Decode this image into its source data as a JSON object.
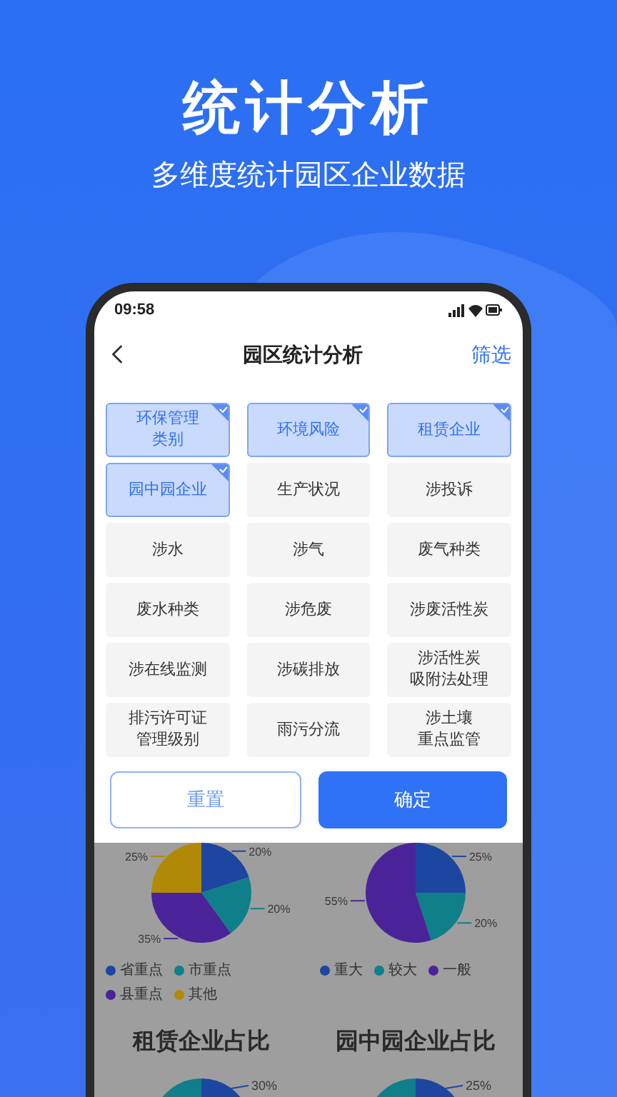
{
  "hero": {
    "title": "统计分析",
    "subtitle": "多维度统计园区企业数据"
  },
  "status_bar": {
    "time": "09:58"
  },
  "nav": {
    "title": "园区统计分析",
    "action": "筛选"
  },
  "filters": [
    {
      "lines": [
        "环保管理",
        "类别"
      ],
      "selected": true
    },
    {
      "lines": [
        "环境风险"
      ],
      "selected": true
    },
    {
      "lines": [
        "租赁企业"
      ],
      "selected": true
    },
    {
      "lines": [
        "园中园企业"
      ],
      "selected": true
    },
    {
      "lines": [
        "生产状况"
      ],
      "selected": false
    },
    {
      "lines": [
        "涉投诉"
      ],
      "selected": false
    },
    {
      "lines": [
        "涉水"
      ],
      "selected": false
    },
    {
      "lines": [
        "涉气"
      ],
      "selected": false
    },
    {
      "lines": [
        "废气种类"
      ],
      "selected": false
    },
    {
      "lines": [
        "废水种类"
      ],
      "selected": false
    },
    {
      "lines": [
        "涉危废"
      ],
      "selected": false
    },
    {
      "lines": [
        "涉废活性炭"
      ],
      "selected": false
    },
    {
      "lines": [
        "涉在线监测"
      ],
      "selected": false
    },
    {
      "lines": [
        "涉碳排放"
      ],
      "selected": false
    },
    {
      "lines": [
        "涉活性炭",
        "吸附法处理"
      ],
      "selected": false
    },
    {
      "lines": [
        "排污许可证",
        "管理级别"
      ],
      "selected": false
    },
    {
      "lines": [
        "雨污分流"
      ],
      "selected": false
    },
    {
      "lines": [
        "涉土壤",
        "重点监管"
      ],
      "selected": false
    }
  ],
  "buttons": [
    {
      "label": "重置",
      "kind": "outline"
    },
    {
      "label": "确定",
      "kind": "primary"
    }
  ],
  "charts": [
    {
      "chart_data": {
        "type": "pie",
        "categories": [
          "省重点",
          "市重点",
          "县重点",
          "其他"
        ],
        "values": [
          20,
          20,
          35,
          25
        ],
        "colors": [
          "#1d46a0",
          "#0f7f8a",
          "#4b2399",
          "#b08a07"
        ],
        "value_labels": [
          "20%",
          "20%",
          "35%",
          "25%"
        ],
        "legend": "bottom"
      }
    },
    {
      "chart_data": {
        "type": "pie",
        "categories": [
          "重大",
          "较大",
          "一般"
        ],
        "values": [
          25,
          20,
          55
        ],
        "colors": [
          "#1d46a0",
          "#0f7f8a",
          "#4b2399"
        ],
        "value_labels": [
          "25%",
          "20%",
          "55%"
        ],
        "legend": "bottom"
      }
    }
  ],
  "lower_charts": [
    {
      "title": "租赁企业占比",
      "label": "30%"
    },
    {
      "title": "园中园企业占比",
      "label": "25%"
    }
  ]
}
